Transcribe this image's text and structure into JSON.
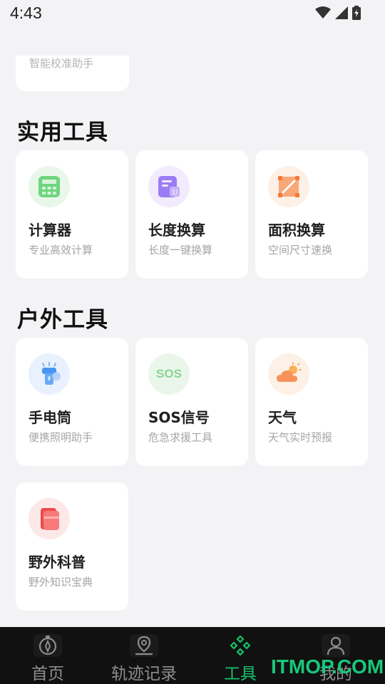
{
  "status_bar": {
    "time": "4:43"
  },
  "partial_card": {
    "subtitle": "智能校准助手"
  },
  "sections": [
    {
      "title": "实用工具",
      "cards": [
        {
          "title": "计算器",
          "subtitle": "专业高效计算",
          "icon": "calculator-icon",
          "color": "#4cc96b"
        },
        {
          "title": "长度换算",
          "subtitle": "长度一键换算",
          "icon": "ruler-icon",
          "color": "#8f6cf0"
        },
        {
          "title": "面积换算",
          "subtitle": "空间尺寸速换",
          "icon": "area-icon",
          "color": "#f5894a"
        }
      ]
    },
    {
      "title": "户外工具",
      "cards": [
        {
          "title": "手电筒",
          "subtitle": "便携照明助手",
          "icon": "flashlight-icon",
          "color": "#3f8ef0"
        },
        {
          "title": "SOS信号",
          "subtitle": "危急求援工具",
          "icon": "sos-icon",
          "color": "#5cc86c",
          "icon_text": "SOS"
        },
        {
          "title": "天气",
          "subtitle": "天气实时预报",
          "icon": "weather-icon",
          "color": "#f59b4a"
        },
        {
          "title": "野外科普",
          "subtitle": "野外知识宝典",
          "icon": "book-icon",
          "color": "#f04b4b"
        }
      ]
    }
  ],
  "tab_bar": {
    "tabs": [
      {
        "label": "首页",
        "icon": "compass-icon",
        "active": false
      },
      {
        "label": "轨迹记录",
        "icon": "location-pin-icon",
        "active": false
      },
      {
        "label": "工具",
        "icon": "tools-icon",
        "active": true
      },
      {
        "label": "我的",
        "icon": "person-icon",
        "active": false
      }
    ],
    "active_color": "#14c26b"
  },
  "watermark": "ITMOP.COM"
}
